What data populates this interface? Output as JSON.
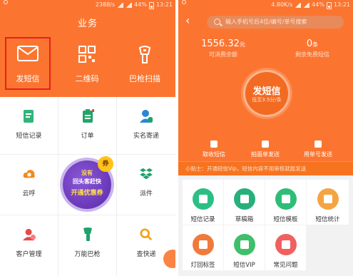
{
  "left": {
    "status": {
      "speed": "2388/s",
      "battery": "44%",
      "time": "13:21"
    },
    "title": "业务",
    "header_actions": [
      {
        "label": "发短信",
        "icon": "envelope-icon",
        "selected": true
      },
      {
        "label": "二维码",
        "icon": "qrcode-icon"
      },
      {
        "label": "巴枪扫描",
        "icon": "scanner-icon"
      }
    ],
    "grid": [
      {
        "label": "短信记录",
        "icon": "sms-record-icon",
        "color": "#2fb67b"
      },
      {
        "label": "订单",
        "icon": "clipboard-icon",
        "color": "#23a468"
      },
      {
        "label": "实名寄递",
        "icon": "user-check-icon",
        "color": "#2a86d8"
      },
      {
        "label": "云呼",
        "icon": "cloud-phone-icon",
        "color": "#f28a1c"
      },
      {
        "label": "派件",
        "icon": "dropbox-icon",
        "color": "#1ea36b"
      },
      {
        "label": "客户管理",
        "icon": "customer-icon",
        "color": "#e24b4b"
      },
      {
        "label": "万能巴枪",
        "icon": "scan-gun-icon",
        "color": "#1ea36b"
      },
      {
        "label": "查快递",
        "icon": "search-icon",
        "color": "#f2a21a"
      }
    ],
    "promo": {
      "line1": "没有",
      "line2": "回头客赶快",
      "line3": "开通优惠券",
      "tag": "券"
    }
  },
  "right": {
    "status": {
      "speed": "4.80K/s",
      "battery": "44%",
      "time": "13:21"
    },
    "search_placeholder": "输入手机号后4位/编号/单号搜索",
    "balance": {
      "amount": "1556.32",
      "unit": "元",
      "label": "可消费余额"
    },
    "free_sms": {
      "amount": "0",
      "unit": "条",
      "label": "剩余免费短信"
    },
    "send_button": {
      "label": "发短信",
      "sub": "低至3.5分/条"
    },
    "quick_actions": [
      {
        "label": "取收短信",
        "icon": "upload-icon"
      },
      {
        "label": "拍面单发送",
        "icon": "camera-icon"
      },
      {
        "label": "用单号发送",
        "icon": "edit-icon"
      }
    ],
    "tip": "小贴士：开通短信Vip，短信内容不用审核就能发送",
    "tiles": [
      {
        "label": "短信记录",
        "icon": "sms-record-icon",
        "color": "#2cbf84"
      },
      {
        "label": "草稿箱",
        "icon": "draft-icon",
        "color": "#27b07b"
      },
      {
        "label": "短信模板",
        "icon": "template-icon",
        "color": "#2ebd78"
      },
      {
        "label": "短信统计",
        "icon": "chart-icon",
        "color": "#f4a542"
      },
      {
        "label": "灯回标签",
        "icon": "bookmark-icon",
        "color": "#f07a3c"
      },
      {
        "label": "短信VIP",
        "icon": "vip-icon",
        "color": "#3fbf6a"
      },
      {
        "label": "常见问题",
        "icon": "question-icon",
        "color": "#f06060"
      }
    ]
  }
}
